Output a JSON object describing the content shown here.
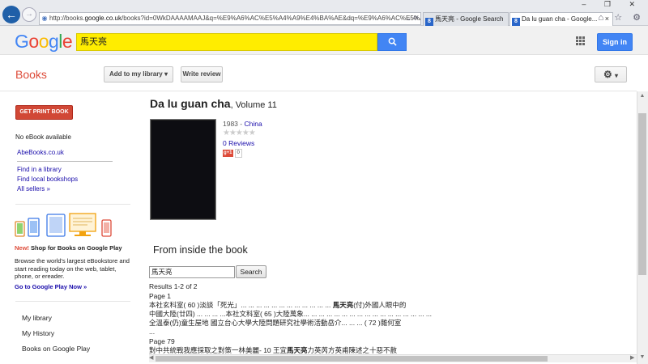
{
  "browser": {
    "address": {
      "pre": "http://books.",
      "domain": "google.co.uk",
      "post": "/books?id=0WkDAAAAMAAJ&q=%E9%A6%AC%E5%A4%A9%E4%BA%AE&dq=%E9%A6%AC%E5%A4%A9%E4%BA%AE&hl"
    },
    "tabs": [
      {
        "label": "馬天亮 - Google Search",
        "icon": "google-favicon"
      },
      {
        "label": "Da lu guan cha - Google...",
        "icon": "google-favicon"
      }
    ],
    "tab_close": "×",
    "window_controls": "– ❐ ✕",
    "ie_icons": "⌂ ☆ ⚙"
  },
  "header": {
    "logo": [
      "G",
      "o",
      "o",
      "g",
      "l",
      "e"
    ],
    "logo_colors": [
      "#4285f4",
      "#ea4335",
      "#fbbc05",
      "#4285f4",
      "#34a853",
      "#ea4335"
    ],
    "search_value": "馬天亮",
    "signin": "Sign in"
  },
  "subheader": {
    "section": "Books",
    "add_library": "Add to my library",
    "write_review": "Write review",
    "caret": "▾"
  },
  "sidebar": {
    "get_print": "GET PRINT BOOK",
    "no_ebook": "No eBook available",
    "abebooks": "AbeBooks.co.uk",
    "find_library": "Find in a library",
    "find_local": "Find local bookshops",
    "all_sellers": "All sellers »",
    "promo_new": "New!",
    "promo_title": " Shop for Books on Google Play",
    "promo_body": "Browse the world's largest eBookstore and start reading today on the web, tablet, phone, or ereader.",
    "promo_link": "Go to Google Play Now »",
    "links": [
      "My library",
      "My History",
      "Books on Google Play"
    ]
  },
  "book": {
    "title": "Da lu guan cha",
    "volume": ", Volume 11",
    "year": "1983 - ",
    "subject": "China",
    "stars": "★★★★★",
    "reviews": "0 Reviews",
    "gplus": "g+1",
    "gplus_count": "0"
  },
  "inside": {
    "heading": "From inside the book",
    "query": "馬天亮",
    "search_btn": "Search",
    "results": "Results 1-2 of 2",
    "page1": "Page 1",
    "r1a_pre": "本社玄科室( 60 )淡談「死光」... ... ... ... ... ... ... ... ... ... ... ... ",
    "r1a_hl": "馬天亮",
    "r1a_post": "(付)外國人眼中的",
    "r1b": "中國大陸(廿四) ... ... ... ...本社文科室( 65 )大陸萬象... ... ... ... ... ... ... ... ... ... ... ... ... ... ... ... ...",
    "r1c": "全溫泰(仍)童生屋地 國立台心大學大陸問題研究社學術活動岳介... ... ... ( 72 )雜何室",
    "r1d": "...",
    "page2": "Page 79",
    "r2a_pre": "對中共統戰我應採取之對策一林美麗- 10 王宜",
    "r2a_hl": "馬天亮",
    "r2a_post": "力英芮方英甫陳述之十惡不赦"
  },
  "scroll": {
    "up": "▲",
    "down": "▼",
    "left": "◀",
    "right": "▶"
  }
}
